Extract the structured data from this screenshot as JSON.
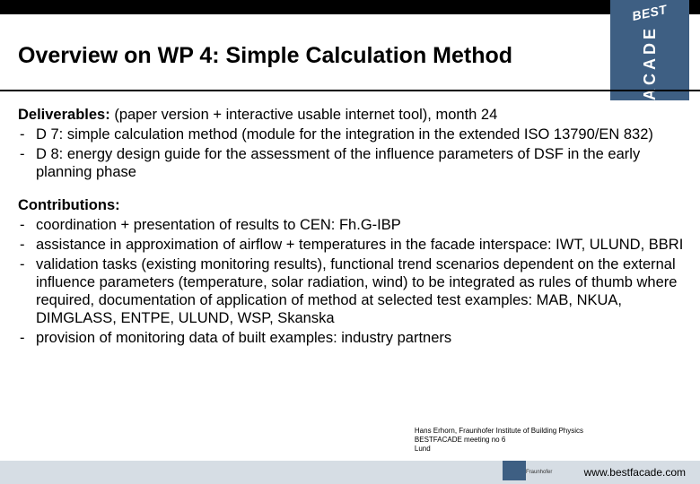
{
  "logo": {
    "top": "BEST",
    "main": "FACADE"
  },
  "title": "Overview on WP 4: Simple Calculation Method",
  "deliverables": {
    "heading": "Deliverables:",
    "sub": " (paper version + interactive usable internet tool), month 24",
    "items": [
      "D 7: simple calculation method (module for the integration in the extended ISO 13790/EN 832)",
      "D 8: energy design guide for the assessment of the influence parameters of DSF in the early planning phase"
    ]
  },
  "contributions": {
    "heading": "Contributions:",
    "items": [
      "coordination + presentation of results to CEN: Fh.G-IBP",
      "assistance in approximation of airflow + temperatures in the facade interspace: IWT, ULUND, BBRI",
      "validation tasks (existing monitoring results), functional trend scenarios dependent on the external influence parameters (temperature, solar radiation, wind) to be integrated as rules of thumb where required, documentation of application of method at selected test examples: MAB, NKUA, DIMGLASS, ENTPE, ULUND, WSP, Skanska",
      "provision of monitoring data of built examples: industry partners"
    ]
  },
  "credit": {
    "line1": "Hans Erhorn, Fraunhofer Institute of Building Physics",
    "line2": "BESTFACADE meeting no 6",
    "line3": "Lund"
  },
  "footer": {
    "url": "www.bestfacade.com",
    "small": "Fraunhofer"
  }
}
